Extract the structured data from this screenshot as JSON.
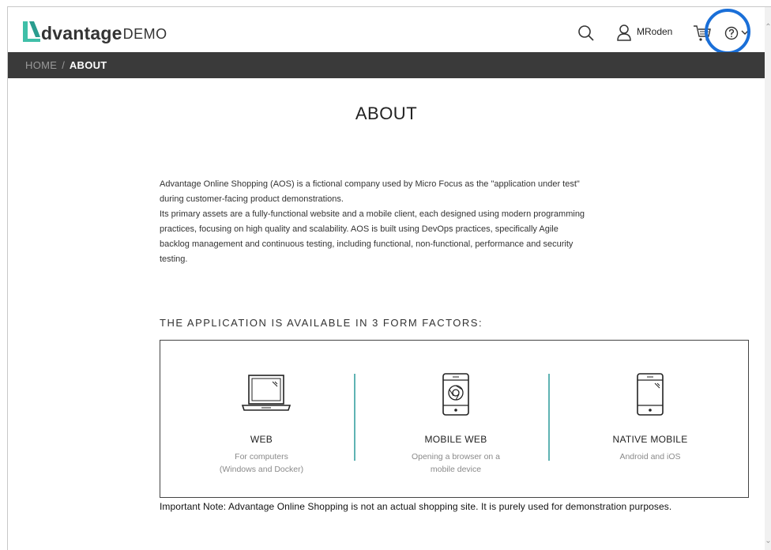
{
  "header": {
    "logo_brand": "dvantage",
    "logo_demo": "DEMO",
    "user_name": "MRoden",
    "icons": [
      "search-icon",
      "user-icon",
      "cart-icon",
      "help-icon",
      "chevron-down-icon"
    ]
  },
  "breadcrumb": {
    "home": "HOME",
    "separator": "/",
    "current": "ABOUT"
  },
  "main": {
    "title": "ABOUT",
    "intro_lines": [
      "Advantage Online Shopping (AOS) is a fictional company used by Micro Focus as the \"application under test\"",
      "during customer-facing product demonstrations.",
      "Its primary assets are a fully-functional website and a mobile client, each designed using modern programming",
      "practices, focusing on high quality and scalability.  AOS is built using DevOps practices, specifically Agile",
      "backlog management and continuous testing, including functional, non-functional, performance and security",
      "testing."
    ],
    "factors_heading": "THE APPLICATION IS AVAILABLE IN 3 FORM FACTORS:",
    "factors": [
      {
        "title": "WEB",
        "desc_line1": "For computers",
        "desc_line2": "(Windows and Docker)",
        "icon": "laptop-icon"
      },
      {
        "title": "MOBILE WEB",
        "desc_line1": "Opening a browser on a",
        "desc_line2": "mobile device",
        "icon": "mobile-browser-icon"
      },
      {
        "title": "NATIVE MOBILE",
        "desc_line1": "Android and iOS",
        "desc_line2": "",
        "icon": "mobile-phone-icon"
      }
    ],
    "note": "Important Note: Advantage Online Shopping is not an actual shopping site.  It is purely used for demonstration purposes."
  },
  "colors": {
    "logo_accent": "#3fbfa8",
    "breadcrumb_bg": "#3a3a3a",
    "divider": "#5fb3b3",
    "highlight_ring": "#1a6fd8"
  }
}
